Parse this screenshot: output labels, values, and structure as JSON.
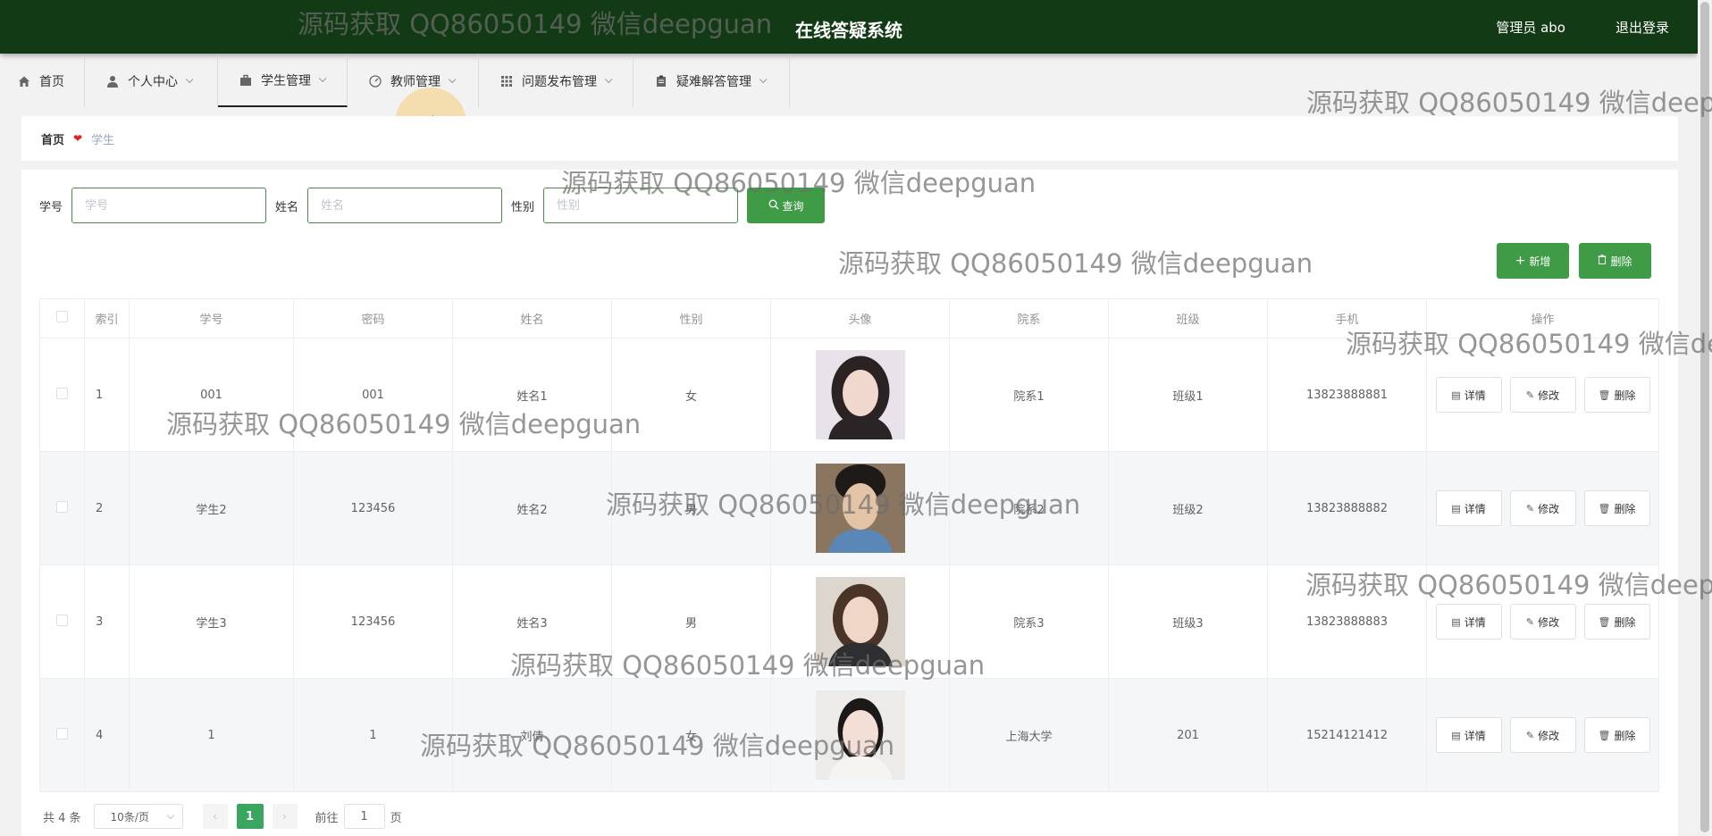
{
  "header": {
    "title": "在线答疑系统",
    "admin": "管理员 abo",
    "logout": "退出登录"
  },
  "nav": [
    {
      "label": "首页",
      "icon": "home-icon",
      "has_menu": false
    },
    {
      "label": "个人中心",
      "icon": "user-icon",
      "has_menu": true
    },
    {
      "label": "学生管理",
      "icon": "briefcase-icon",
      "has_menu": true,
      "active": true
    },
    {
      "label": "教师管理",
      "icon": "gauge-icon",
      "has_menu": true
    },
    {
      "label": "问题发布管理",
      "icon": "grid-icon",
      "has_menu": true
    },
    {
      "label": "疑难解答管理",
      "icon": "clipboard-icon",
      "has_menu": true
    }
  ],
  "breadcrumb": {
    "home": "首页",
    "current": "学生"
  },
  "search": {
    "xuehao_label": "学号",
    "xuehao_placeholder": "学号",
    "name_label": "姓名",
    "name_placeholder": "姓名",
    "gender_label": "性别",
    "gender_placeholder": "性别",
    "button": "查询"
  },
  "actions": {
    "add": "新增",
    "delete": "删除"
  },
  "table": {
    "columns": [
      "索引",
      "学号",
      "密码",
      "姓名",
      "性别",
      "头像",
      "院系",
      "班级",
      "手机",
      "操作"
    ],
    "rows": [
      {
        "index": "1",
        "xuehao": "001",
        "password": "001",
        "name": "姓名1",
        "gender": "女",
        "dept": "院系1",
        "class": "班级1",
        "phone": "13823888881"
      },
      {
        "index": "2",
        "xuehao": "学生2",
        "password": "123456",
        "name": "姓名2",
        "gender": "男",
        "dept": "院系2",
        "class": "班级2",
        "phone": "13823888882"
      },
      {
        "index": "3",
        "xuehao": "学生3",
        "password": "123456",
        "name": "姓名3",
        "gender": "男",
        "dept": "院系3",
        "class": "班级3",
        "phone": "13823888883"
      },
      {
        "index": "4",
        "xuehao": "1",
        "password": "1",
        "name": "刘倩",
        "gender": "女",
        "dept": "上海大学",
        "class": "201",
        "phone": "15214121412"
      }
    ],
    "row_actions": {
      "detail": "详情",
      "edit": "修改",
      "delete": "删除"
    }
  },
  "pagination": {
    "total": "共 4 条",
    "page_size": "10条/页",
    "current_page": "1",
    "goto_label": "前往",
    "goto_value": "1",
    "page_suffix": "页"
  },
  "watermark": "源码获取 QQ86050149 微信deepguan",
  "colors": {
    "header_bg": "#123a15",
    "primary_green": "#3f9b45",
    "page_active": "#3aa55e"
  }
}
